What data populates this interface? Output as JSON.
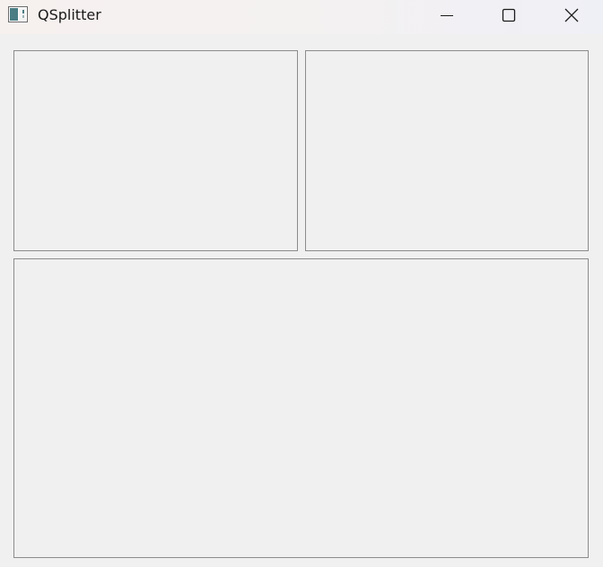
{
  "window": {
    "title": "QSplitter",
    "app_icon": "qt-window-icon"
  },
  "caption_buttons": {
    "minimize_icon": "minimize-icon",
    "maximize_icon": "maximize-icon",
    "close_icon": "close-icon"
  },
  "panes": [
    "top-left",
    "top-right",
    "bottom"
  ],
  "colors": {
    "background": "#f0f0f0",
    "pane_border": "#8c8c8c"
  }
}
